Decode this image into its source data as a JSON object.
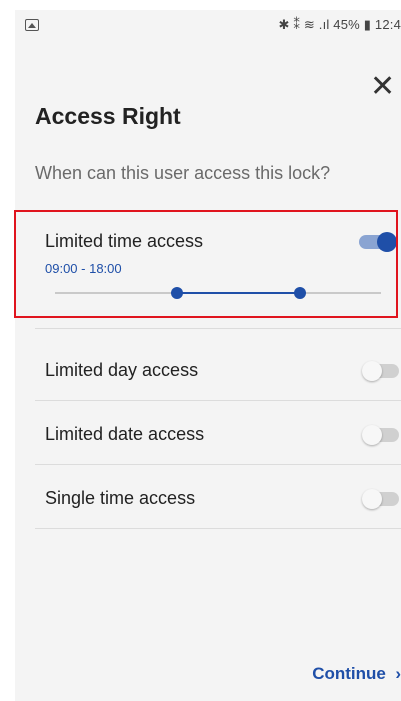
{
  "status_bar": {
    "right_text": "✱ ⁑ ≋ .ıl 45% ▮ 12:4"
  },
  "header": {
    "title": "Access Right",
    "subtitle": "When can this user access this lock?"
  },
  "options": [
    {
      "label": "Limited time access",
      "enabled": true,
      "range": "09:00 - 18:00",
      "slider_start": 0.375,
      "slider_end": 0.75
    },
    {
      "label": "Limited day access",
      "enabled": false
    },
    {
      "label": "Limited date access",
      "enabled": false
    },
    {
      "label": "Single time access",
      "enabled": false
    }
  ],
  "footer": {
    "continue_label": "Continue",
    "continue_icon": "chevron-right-icon"
  },
  "colors": {
    "accent": "#1f4fa8",
    "highlight": "#e0141e",
    "background": "#f4f4f4"
  }
}
